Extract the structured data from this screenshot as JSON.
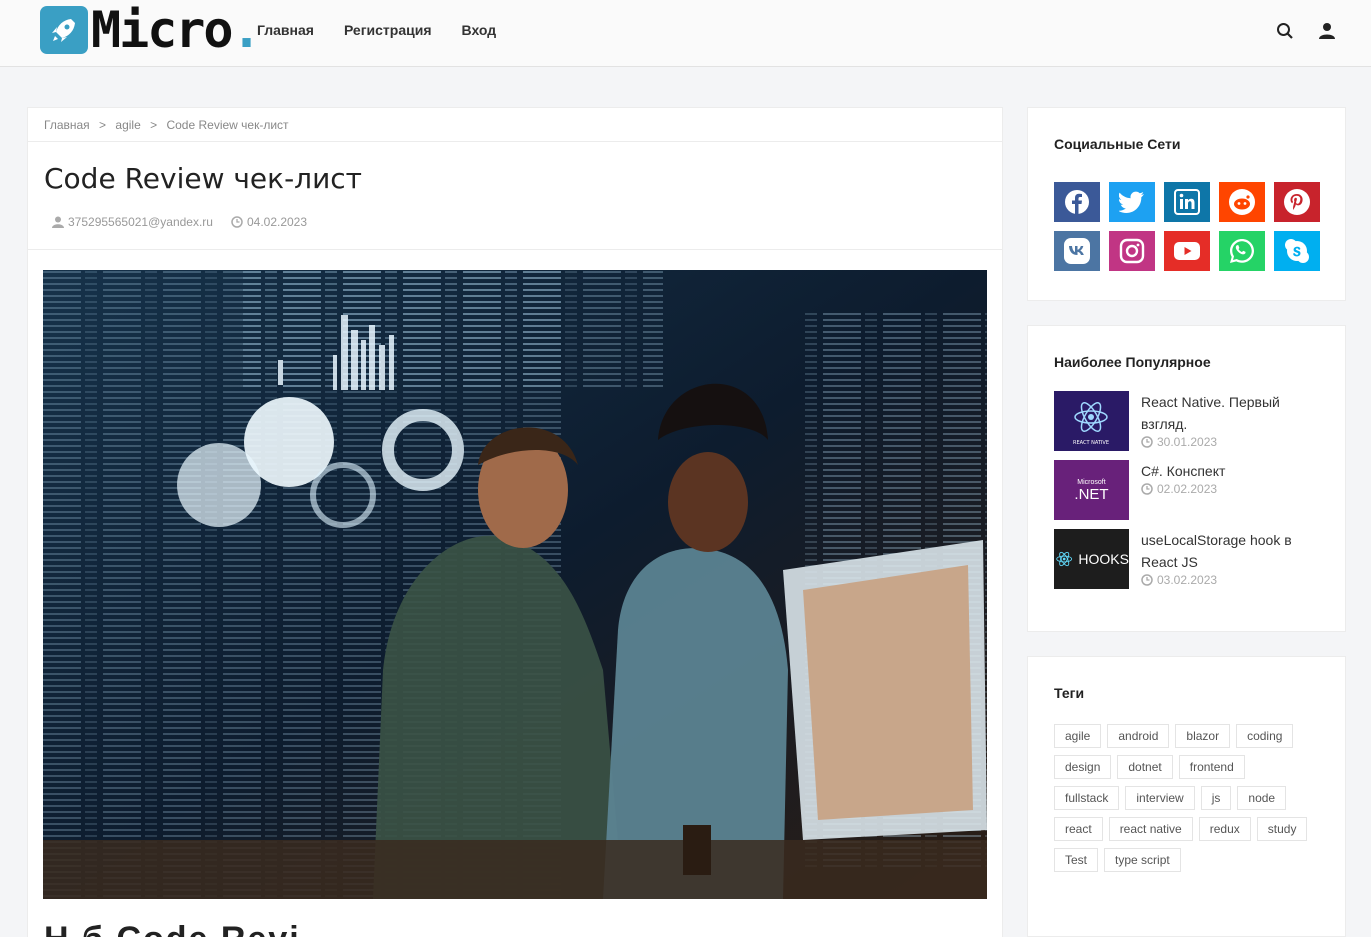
{
  "header": {
    "logo_text": "Micro",
    "logo_dot": ".",
    "nav": [
      "Главная",
      "Регистрация",
      "Вход"
    ],
    "icons": [
      "search-icon",
      "user-icon"
    ]
  },
  "breadcrumb": [
    "Главная",
    ">",
    "agile",
    ">",
    "Code Review чек-лист"
  ],
  "article": {
    "title": "Code Review чек-лист",
    "author": "375295565021@yandex.ru",
    "date": "04.02.2023",
    "next_heading_partial": "Н        б                                        Code Revi"
  },
  "social": {
    "title": "Социальные Сети",
    "networks": [
      {
        "name": "facebook",
        "color": "#3b5998"
      },
      {
        "name": "twitter",
        "color": "#1da1f2"
      },
      {
        "name": "linkedin",
        "color": "#0e76a8"
      },
      {
        "name": "reddit",
        "color": "#ff4500"
      },
      {
        "name": "pinterest",
        "color": "#c8232c"
      },
      {
        "name": "vk",
        "color": "#4c75a3"
      },
      {
        "name": "instagram",
        "color": "#c13584"
      },
      {
        "name": "youtube",
        "color": "#e52d27"
      },
      {
        "name": "whatsapp",
        "color": "#25d366"
      },
      {
        "name": "skype",
        "color": "#00aff0"
      }
    ]
  },
  "popular": {
    "title": "Наиболее Популярное",
    "items": [
      {
        "title": "React Native. Первый взгляд.",
        "date": "30.01.2023",
        "thumb_color": "#2a1a66",
        "thumb_label": "REACT NATIVE"
      },
      {
        "title": "C#. Конспект",
        "date": "02.02.2023",
        "thumb_color": "#68217a",
        "thumb_label": ".NET"
      },
      {
        "title": "useLocalStorage hook в React JS",
        "date": "03.02.2023",
        "thumb_color": "#1d1d1d",
        "thumb_label": "HOOKS"
      }
    ]
  },
  "tags": {
    "title": "Теги",
    "items": [
      "agile",
      "android",
      "blazor",
      "coding",
      "design",
      "dotnet",
      "frontend",
      "fullstack",
      "interview",
      "js",
      "node",
      "react",
      "react native",
      "redux",
      "study",
      "Test",
      "type script"
    ]
  }
}
